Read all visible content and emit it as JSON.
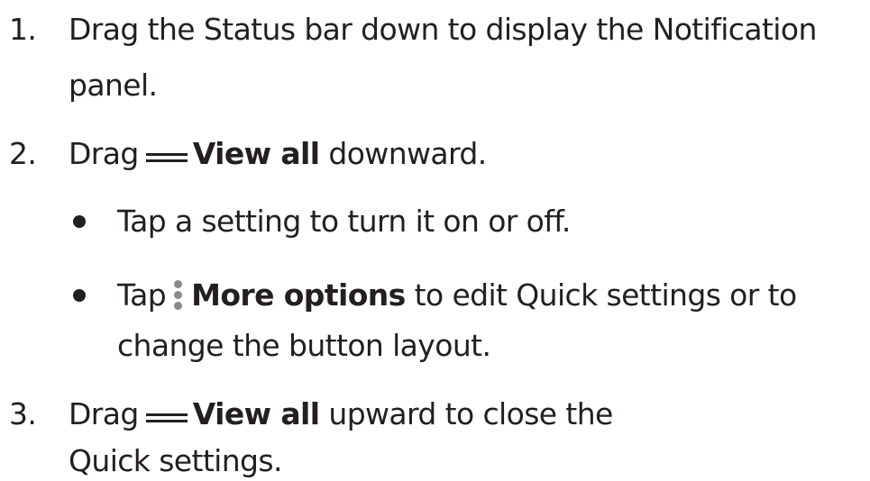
{
  "steps": [
    {
      "number": "1.",
      "line1": "Drag the Status bar down to display the Notification",
      "line2": "panel."
    },
    {
      "number": "2.",
      "pre": "Drag",
      "bold": "View all",
      "post": "downward.",
      "icon": "drag-handle-icon",
      "bullets": [
        {
          "text": "Tap a setting to turn it on or off."
        },
        {
          "pre": "Tap",
          "icon": "more-options-icon",
          "bold": "More options",
          "post": "to edit Quick settings or to",
          "line2": "change the button layout."
        }
      ]
    },
    {
      "number": "3.",
      "pre": "Drag",
      "bold": "View all",
      "post": "upward to close the",
      "line2": "Quick settings.",
      "icon": "drag-handle-icon"
    }
  ]
}
